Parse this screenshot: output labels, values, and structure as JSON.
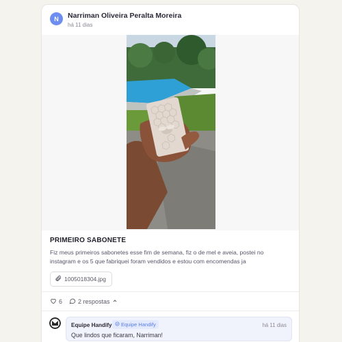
{
  "post": {
    "author_initial": "N",
    "author": "Narriman Oliveira Peralta Moreira",
    "time": "há 11 dias",
    "title": "PRIMEIRO SABONETE",
    "body": "Fiz meus primeiros sabonetes esse fim de semana, fiz o de mel e aveia, postei no instagram e os 5 que fabriquei foram vendidos e estou com encomendas ja",
    "attachment": "1005018304.jpg",
    "likes": "6",
    "replies_label": "2 respostas"
  },
  "reply": {
    "author": "Equipe Handify",
    "badge": "Equipe Handify",
    "time": "há 11 dias",
    "text": "Que lindos que ficaram, Narriman!"
  },
  "colors": {
    "page_bg": "#f4f3ee",
    "avatar": "#6d8ef0",
    "badge_text": "#5a7ce6",
    "reply_bg": "#f0f3fb"
  },
  "icons": [
    "heart-icon",
    "comment-icon",
    "chevron-up-icon",
    "paperclip-icon",
    "verified-icon"
  ]
}
